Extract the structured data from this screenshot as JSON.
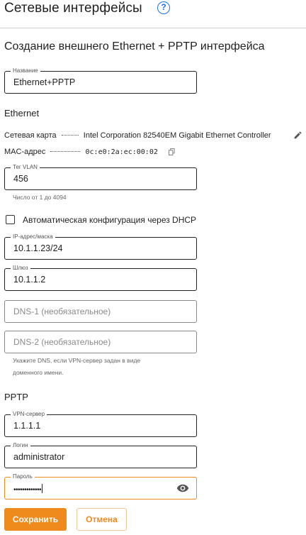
{
  "header": {
    "title": "Сетевые интерфейсы",
    "help_icon": "help-circle-icon"
  },
  "form": {
    "title": "Создание внешнего Ethernet + PPTP интерфейса"
  },
  "fields": {
    "name": {
      "label": "Название",
      "value": "Ethernet+PPTP"
    },
    "vlan": {
      "label": "Тег VLAN",
      "value": "456",
      "hint": "Число от 1 до 4094"
    },
    "ip": {
      "label": "IP-адрес/маска",
      "value": "10.1.1.23/24"
    },
    "gateway": {
      "label": "Шлюз",
      "value": "10.1.1.2"
    },
    "dns1": {
      "placeholder": "DNS-1 (необязательное)"
    },
    "dns2": {
      "placeholder": "DNS-2 (необязательное)",
      "hint_line1": "Укажите DNS, если VPN-сервер задан в виде",
      "hint_line2": "доменного имени."
    },
    "vpn_server": {
      "label": "VPN-сервер",
      "value": "1.1.1.1"
    },
    "login": {
      "label": "Логин",
      "value": "administrator"
    },
    "password": {
      "label": "Пароль",
      "value": "•••••••••••••"
    }
  },
  "ethernet": {
    "section_title": "Ethernet",
    "network_card_label": "Сетевая карта",
    "network_card_value": "Intel Corporation 82540EM Gigabit Ethernet Controller",
    "mac_label": "MAC-адрес",
    "mac_value": "0c:e0:2a:ec:00:02"
  },
  "dhcp": {
    "label": "Автоматическая конфигурация через DHCP",
    "checked": false
  },
  "pptp": {
    "section_title": "PPTP"
  },
  "buttons": {
    "save": "Сохранить",
    "cancel": "Отмена"
  },
  "colors": {
    "accent": "#ef8a1d",
    "help": "#1a73e8"
  }
}
